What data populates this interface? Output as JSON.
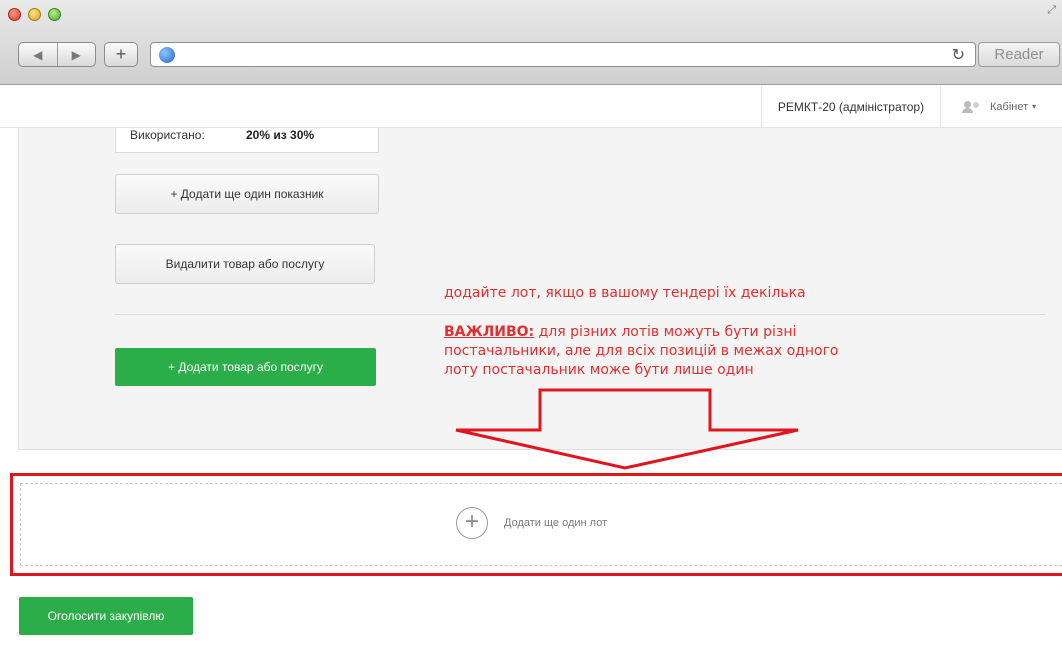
{
  "browser": {
    "reader_label": "Reader",
    "icons": {
      "back": "back-arrow-icon",
      "forward": "forward-arrow-icon",
      "new_tab": "plus-icon",
      "globe": "globe-icon",
      "reload": "reload-icon"
    }
  },
  "header": {
    "user_label": "РЕМКТ-20 (адміністратор)",
    "cabinet_label": "Кабінет"
  },
  "panel": {
    "used_label": "Використано:",
    "used_value": "20% из 30%",
    "add_indicator_label": "+ Додати ще один показник",
    "delete_item_label": "Видалити товар або послугу",
    "add_item_label": "+ Додати товар або послугу"
  },
  "annotations": {
    "note_add_lot": "додайте лот, якщо в вашому тендері їх декілька",
    "important_label": "ВАЖЛИВО:",
    "important_text": " для різних лотів можуть бути різні постачальники, але для всіх позицій в межах одного лоту постачальник може бути лише один",
    "accent_color": "#e0161f"
  },
  "lot": {
    "add_lot_label": "Додати ще один лот"
  },
  "footer": {
    "announce_label": "Оголосити закупівлю",
    "green_color": "#2bae4a"
  }
}
